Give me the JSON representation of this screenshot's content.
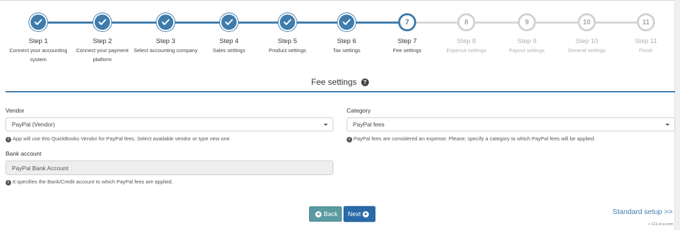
{
  "stepper": {
    "steps": [
      {
        "title": "Step 1",
        "desc": [
          "Connect your accounting",
          "system"
        ],
        "state": "done"
      },
      {
        "title": "Step 2",
        "desc": [
          "Connect your payment",
          "platform"
        ],
        "state": "done"
      },
      {
        "title": "Step 3",
        "desc": [
          "Select accounting company"
        ],
        "state": "done"
      },
      {
        "title": "Step 4",
        "desc": [
          "Sales settings"
        ],
        "state": "done"
      },
      {
        "title": "Step 5",
        "desc": [
          "Product settings"
        ],
        "state": "done"
      },
      {
        "title": "Step 6",
        "desc": [
          "Tax settings"
        ],
        "state": "done"
      },
      {
        "title": "Step 7",
        "desc": [
          "Fee settings"
        ],
        "state": "current",
        "number": "7"
      },
      {
        "title": "Step 8",
        "desc": [
          "Expense settings"
        ],
        "state": "todo",
        "number": "8"
      },
      {
        "title": "Step 9",
        "desc": [
          "Payout settings"
        ],
        "state": "todo",
        "number": "9"
      },
      {
        "title": "Step 10",
        "desc": [
          "General settings"
        ],
        "state": "todo",
        "number": "10"
      },
      {
        "title": "Step 11",
        "desc": [
          "Finish"
        ],
        "state": "todo",
        "number": "11"
      }
    ]
  },
  "section": {
    "title": "Fee settings"
  },
  "form": {
    "vendor": {
      "label": "Vendor",
      "value": "PayPal (Vendor)",
      "hint": "App will use this QuickBooks Vendor for PayPal fees. Select available vendor or type new one."
    },
    "category": {
      "label": "Category",
      "value": "PayPal fees",
      "hint": "PayPal fees are considered an expense. Please; specify a category to which PayPal fees will be applied."
    },
    "bank": {
      "label": "Bank account",
      "value": "PayPal Bank Account",
      "hint": "It specifies the Bank/Credit account to which PayPal fees are applied."
    }
  },
  "buttons": {
    "back": "Back",
    "next": "Next"
  },
  "links": {
    "standard_setup": "Standard setup >>"
  },
  "footer": {
    "tiny": "c 111 et p.com"
  },
  "colors": {
    "accent": "#3f7cac",
    "inactive": "#d2d2d2"
  }
}
